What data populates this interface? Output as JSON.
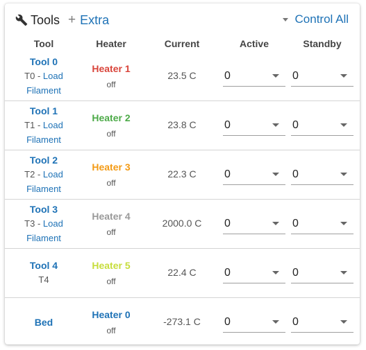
{
  "header": {
    "title": "Tools",
    "extra_label": "Extra",
    "control_all_label": "Control All"
  },
  "columns": {
    "tool": "Tool",
    "heater": "Heater",
    "current": "Current",
    "active": "Active",
    "standby": "Standby"
  },
  "rows": [
    {
      "tool": "Tool 0",
      "tool_prefix": "T0",
      "sep": " - ",
      "load_label": "Load",
      "filament_label": "Filament",
      "heater": "Heater 1",
      "heater_color": "#d9443a",
      "heater_state": "off",
      "current": "23.5 C",
      "active": "0",
      "standby": "0"
    },
    {
      "tool": "Tool 1",
      "tool_prefix": "T1",
      "sep": " - ",
      "load_label": "Load",
      "filament_label": "Filament",
      "heater": "Heater 2",
      "heater_color": "#4caa48",
      "heater_state": "off",
      "current": "23.8 C",
      "active": "0",
      "standby": "0"
    },
    {
      "tool": "Tool 2",
      "tool_prefix": "T2",
      "sep": " - ",
      "load_label": "Load",
      "filament_label": "Filament",
      "heater": "Heater 3",
      "heater_color": "#f39a14",
      "heater_state": "off",
      "current": "22.3 C",
      "active": "0",
      "standby": "0"
    },
    {
      "tool": "Tool 3",
      "tool_prefix": "T3",
      "sep": " - ",
      "load_label": "Load",
      "filament_label": "Filament",
      "heater": "Heater 4",
      "heater_color": "#9a9a9a",
      "heater_state": "off",
      "current": "2000.0 C",
      "active": "0",
      "standby": "0"
    },
    {
      "tool": "Tool 4",
      "tool_prefix": "T4",
      "heater": "Heater 5",
      "heater_color": "#c7dd3c",
      "heater_state": "off",
      "current": "22.4 C",
      "active": "0",
      "standby": "0"
    },
    {
      "tool": "Bed",
      "heater": "Heater 0",
      "heater_color": "#1e72b6",
      "heater_state": "off",
      "current": "-273.1 C",
      "active": "0",
      "standby": "0"
    }
  ]
}
